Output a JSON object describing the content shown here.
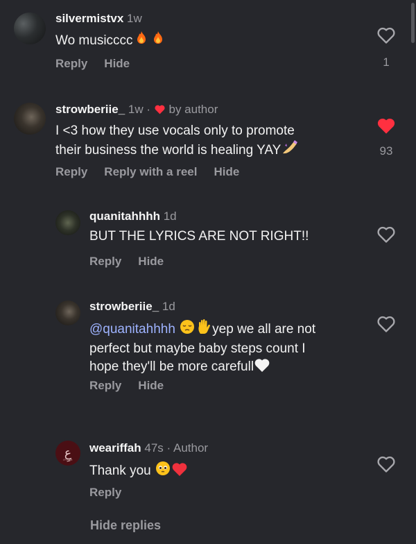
{
  "comments": [
    {
      "username": "silvermistvx",
      "time": "1w",
      "text": "Wo musicccc",
      "actions": {
        "reply": "Reply",
        "hide": "Hide"
      },
      "like_count": "1"
    },
    {
      "username": "strowberiie_",
      "time": "1w",
      "separator": "·",
      "liked_by_author": "by author",
      "text_line1": "I <3 how they use vocals only to promote",
      "text_line2": "their business the world is healing YAY",
      "actions": {
        "reply": "Reply",
        "reply_reel": "Reply with a reel",
        "hide": "Hide"
      },
      "like_count": "93",
      "liked": true
    }
  ],
  "replies": [
    {
      "username": "quanitahhhh",
      "time": "1d",
      "text": "BUT THE LYRICS ARE NOT RIGHT!!",
      "actions": {
        "reply": "Reply",
        "hide": "Hide"
      }
    },
    {
      "username": "strowberiie_",
      "time": "1d",
      "mention": "@quanitahhhh",
      "text_line1_rest": "yep we all are not",
      "text_line2": "perfect but maybe baby steps count I",
      "text_line3": "hope they'll be more carefull",
      "actions": {
        "reply": "Reply",
        "hide": "Hide"
      }
    },
    {
      "username": "weariffah",
      "time": "47s",
      "separator": "·",
      "badge": "Author",
      "text": "Thank you",
      "avatar_glyph": "عِ",
      "avatar_sub": "IFFAH",
      "actions": {
        "reply": "Reply"
      }
    }
  ],
  "hide_replies": "Hide replies",
  "colors": {
    "background": "#26272c",
    "liked_heart": "#ff3040",
    "mention": "#9eb3ff",
    "meta": "#9a9a9f"
  }
}
